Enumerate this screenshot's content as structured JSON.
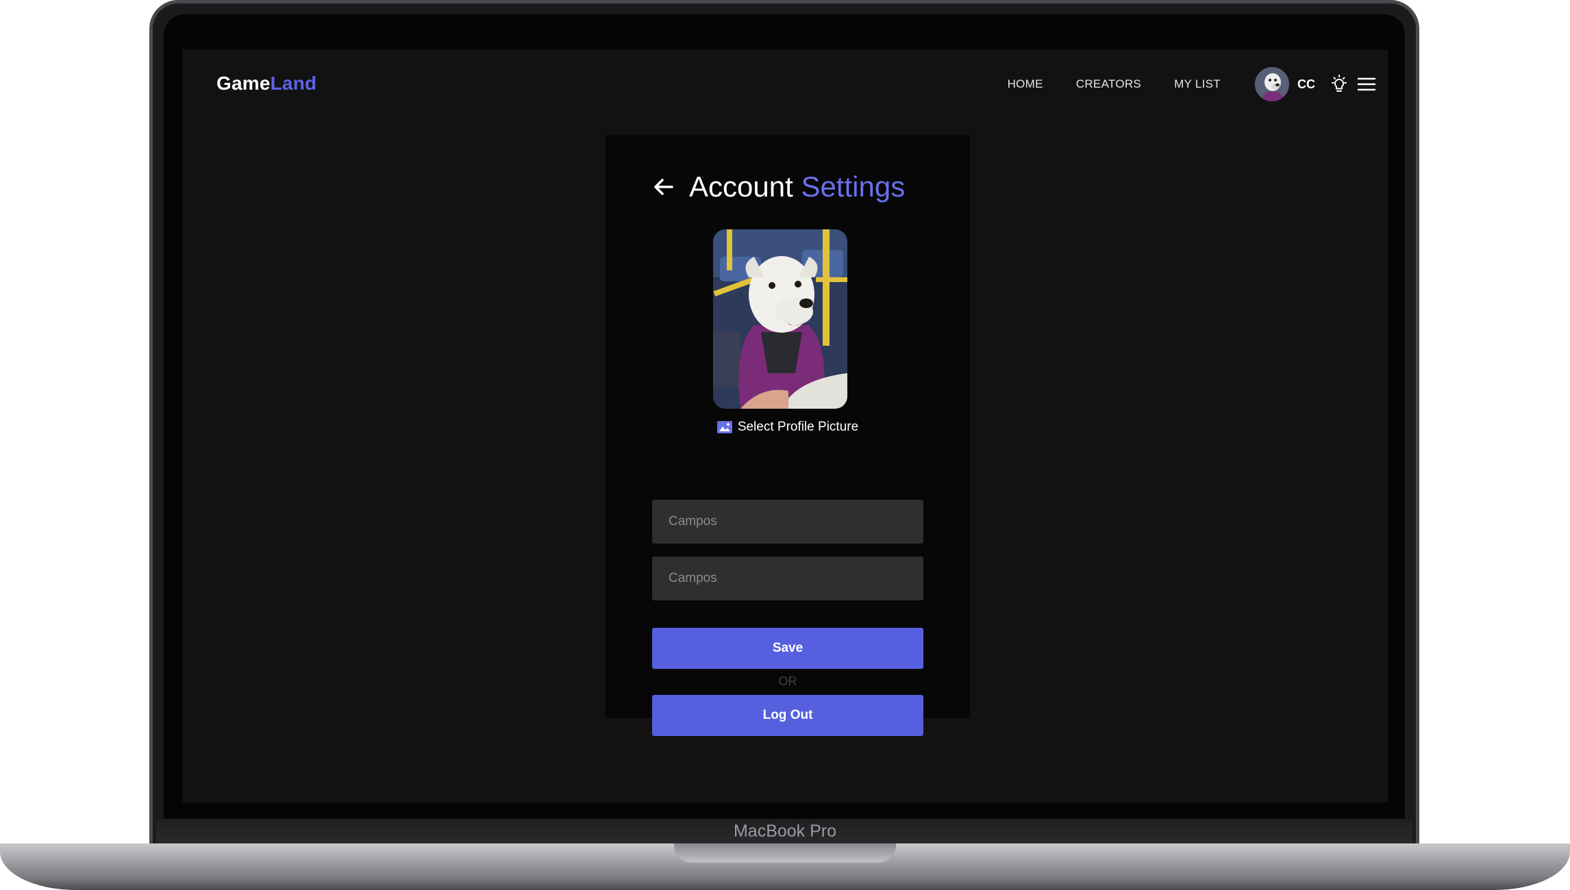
{
  "device": {
    "label": "MacBook Pro"
  },
  "navbar": {
    "logo_primary": "Game",
    "logo_accent": "Land",
    "links": [
      {
        "label": "HOME"
      },
      {
        "label": "CREATORS"
      },
      {
        "label": "MY LIST"
      }
    ],
    "user_initials": "CC",
    "icons": [
      "avatar",
      "lightbulb-icon",
      "hamburger-menu-icon"
    ]
  },
  "settings": {
    "title_primary": "Account",
    "title_accent": "Settings",
    "select_picture_label": "Select Profile Picture",
    "first_field_placeholder": "Campos",
    "second_field_placeholder": "Campos",
    "save_label": "Save",
    "or_label": "OR",
    "logout_label": "Log Out"
  },
  "colors": {
    "accent": "#5b63e6",
    "button": "#5660df",
    "background": "#121212",
    "card": "#070707",
    "input": "#2f2f2f"
  }
}
